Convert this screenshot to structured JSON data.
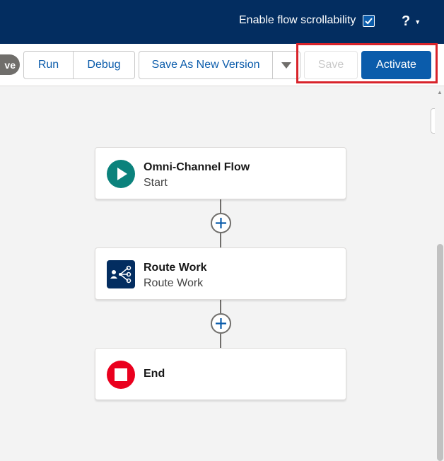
{
  "header": {
    "scroll_label": "Enable flow scrollability",
    "help_label": "?"
  },
  "toolbar": {
    "status_partial": "ve",
    "run_label": "Run",
    "debug_label": "Debug",
    "save_new_version_label": "Save As New Version",
    "save_label": "Save",
    "activate_label": "Activate"
  },
  "flow": {
    "nodes": [
      {
        "title": "Omni-Channel Flow",
        "subtitle": "Start",
        "icon": "play-icon",
        "icon_color": "#0b827c"
      },
      {
        "title": "Route Work",
        "subtitle": "Route Work",
        "icon": "route-work-icon",
        "icon_color": "#032d60"
      },
      {
        "title": "End",
        "subtitle": "",
        "icon": "stop-icon",
        "icon_color": "#ea001e"
      }
    ]
  },
  "colors": {
    "header_bg": "#032d60",
    "brand_blue": "#0b5cab",
    "highlight": "#d8232a"
  }
}
